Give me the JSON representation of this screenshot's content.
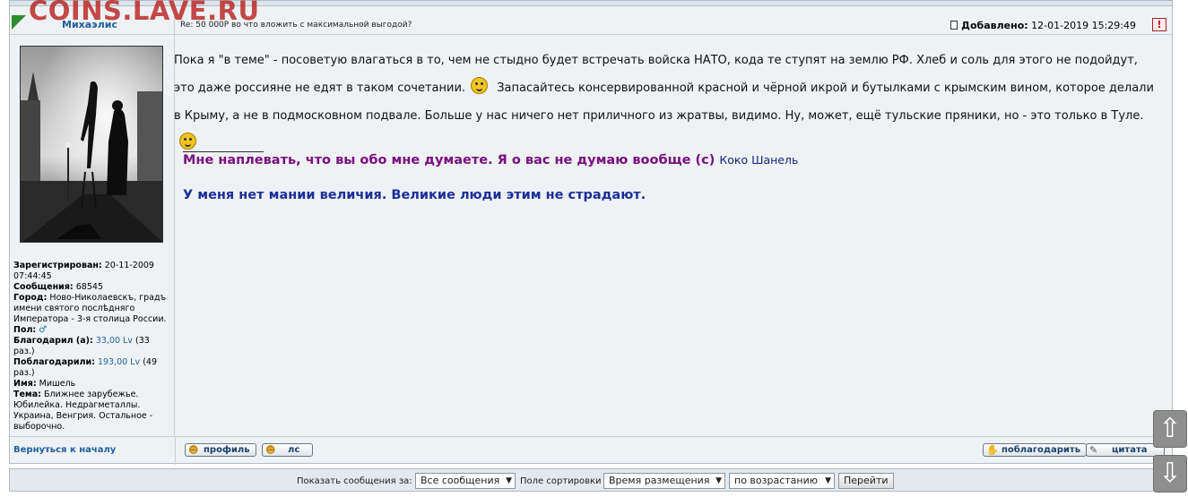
{
  "watermark": "COINS.LAVE.RU",
  "post": {
    "author": "Михаэлис",
    "subject": "Re: 50 000Р во что вложить с максимальной выгодой?",
    "added_label": "Добавлено:",
    "added_value": "12-01-2019 15:29:49",
    "report_icon": "!",
    "body": {
      "p1": "Пока я \"в теме\" - посоветую влагаться в то, чем не стыдно будет встречать войска НАТО, кода те ступят на землю РФ. Хлеб и соль для этого не подойдут, это даже россияне не едят в таком сочетании.",
      "p2": "Запасайтесь консервированной красной и чёрной икрой и бутылками с крымским вином, которое делали в Крыму, а не в подмосковном подвале. Больше у нас ничего нет приличного из жратвы, видимо. Ну, может, ещё тульские пряники, но - это только в Туле."
    },
    "signature": {
      "line": "_______________",
      "quote1": "Мне наплевать, что вы обо мне думаете. Я о вас не думаю вообще (с)",
      "quote1_author": "Коко Шанель",
      "quote2": "У меня нет мании величия. Великие люди этим не страдают."
    }
  },
  "profile": {
    "registered_label": "Зарегистрирован:",
    "registered_value": "20-11-2009 07:44:45",
    "messages_label": "Сообщения:",
    "messages_value": "68545",
    "city_label": "Город:",
    "city_value": "Ново-Николаевскъ, градъ имени святого послѣдняго Императора - 3-я столица России.",
    "sex_label": "Пол:",
    "sex_icon": "♂",
    "thanked_label": "Благодарил (а):",
    "thanked_value": "33,00 Lv",
    "thanked_count": "(33 раз.)",
    "thanks_label": "Поблагодарили:",
    "thanks_value": "193,00 Lv",
    "thanks_count": "(49 раз.)",
    "name_label": "Имя:",
    "name_value": "Мишель",
    "topic_label": "Тема:",
    "topic_value": "Ближнее зарубежье. Юбилейка. Недрагметаллы. Украина, Венгрия. Остальное - выборочно."
  },
  "footer": {
    "back_link": "Вернуться к началу",
    "profile_btn": "профиль",
    "pm_btn": "лс",
    "thank_btn": "поблагодарить",
    "quote_btn": "цитата"
  },
  "bottom_bar": {
    "show_label": "Показать сообщения за:",
    "show_value": "Все сообщения",
    "sort_label": "Поле сортировки",
    "sort_value": "Время размещения",
    "order_value": "по возрастанию",
    "go_label": "Перейти"
  },
  "scroll": {
    "up": "⇧",
    "down": "⇩"
  }
}
